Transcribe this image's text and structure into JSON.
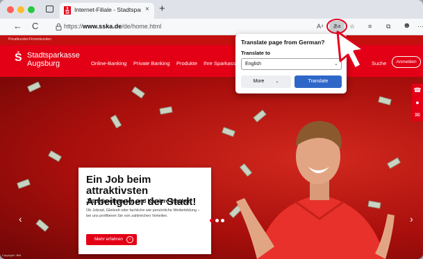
{
  "browser": {
    "tab_title": "Internet-Filiale - Stadtsparkasse",
    "tab_close": "×",
    "new_tab": "+",
    "back_icon": "←",
    "reload_icon": "C",
    "url_prefix": "https://",
    "url_domain": "www.sska.de",
    "url_path": "/de/home.html",
    "read_aloud": "A⁴",
    "translate_icon_label": "あa",
    "fav_icon": "☆",
    "collections_icon": "⧉",
    "profile_icon": "☻",
    "more_icon": "⋯"
  },
  "site": {
    "top_links": [
      "Privatkunden",
      "Firmenkunden"
    ],
    "logo_symbol": "Ṡ",
    "logo_line1": "Stadtsparkasse",
    "logo_line2": "Augsburg",
    "nav": [
      "Online-Banking",
      "Private Banking",
      "Produkte",
      "Ihre Sparkasse"
    ],
    "search_label": "Suche",
    "login_label": "Anmelden"
  },
  "hero": {
    "headline": "Ein Job beim attraktivsten Arbeitgeber der Stadt!",
    "subheadline": "Jetzt durchstarten und Karriere machen",
    "body": "Ob Jobrad, Gleitzeit oder fachliche wie persönliche Weiterbildung – bei uns profitieren Sie von zahlreichen Vorteilen.",
    "cta": "Mehr erfahren",
    "cta_arrow": "›",
    "credit": "Copyright / Bild",
    "arrow_left": "‹",
    "arrow_right": "›"
  },
  "side_tabs": [
    "☎",
    "●",
    "✉"
  ],
  "translate_popup": {
    "title": "Translate page from German?",
    "close": "×",
    "translate_to_label": "Translate to",
    "language": "English",
    "chevron": "⌄",
    "more_label": "More",
    "translate_label": "Translate"
  },
  "colors": {
    "brand_red": "#e30016",
    "translate_blue": "#2f67c9",
    "highlight": "#e3001b"
  }
}
